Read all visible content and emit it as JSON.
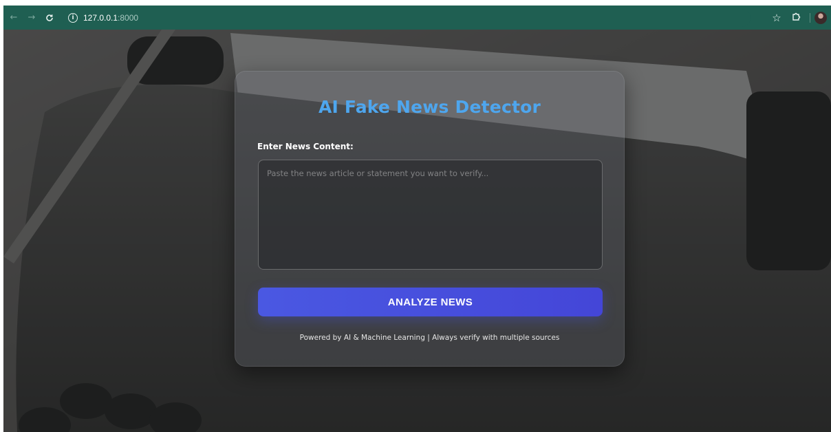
{
  "browser": {
    "back_icon": "arrow-left-icon",
    "forward_icon": "arrow-right-icon",
    "reload_icon": "reload-icon",
    "site_info_icon": "info-icon",
    "url_host": "127.0.0.1",
    "url_port": ":8000",
    "bookmark_icon": "star-icon",
    "extensions_icon": "puzzle-icon",
    "profile_icon": "avatar"
  },
  "card": {
    "title": "AI Fake News Detector",
    "field_label": "Enter News Content:",
    "input_placeholder": "Paste the news article or statement you want to verify...",
    "input_value": "",
    "button_label": "ANALYZE NEWS",
    "footer": "Powered by AI & Machine Learning | Always verify with multiple sources"
  },
  "colors": {
    "chrome_bg": "#1f5f52",
    "title": "#4ea6ee",
    "button": "#4a58e2"
  }
}
